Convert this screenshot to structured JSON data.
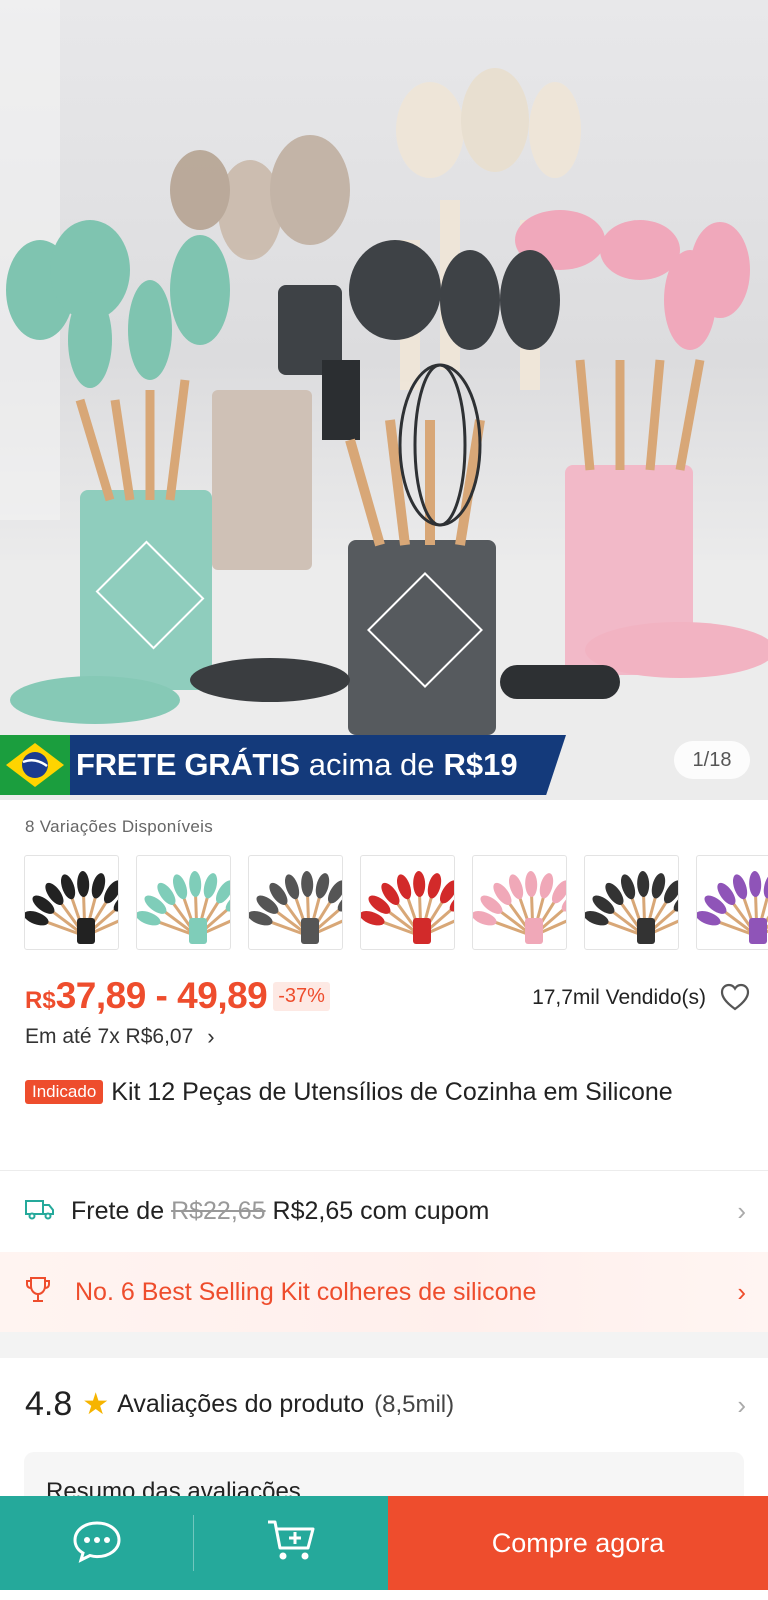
{
  "hero": {
    "frete_bold": "FRETE GRÁTIS",
    "frete_reg": "acima de",
    "frete_price": "R$19",
    "counter": "1/18"
  },
  "variations": {
    "label": "8 Variações Disponíveis",
    "thumbs": [
      {
        "name": "black",
        "color": "#222222"
      },
      {
        "name": "mint",
        "color": "#7fcdb9"
      },
      {
        "name": "gray",
        "color": "#555555"
      },
      {
        "name": "red",
        "color": "#d22a2a"
      },
      {
        "name": "pink",
        "color": "#f0a8b8"
      },
      {
        "name": "mixed",
        "color": "#333333"
      },
      {
        "name": "purple",
        "color": "#8f54b8"
      }
    ]
  },
  "price": {
    "currency": "R$",
    "range": "37,89 - 49,89",
    "discount": "-37%",
    "sold": "17,7mil Vendido(s)",
    "installments_prefix": "Em até",
    "installments_value": "7x R$6,07"
  },
  "product": {
    "badge": "Indicado",
    "title": "Kit 12 Peças de Utensílios de Cozinha em Silicone"
  },
  "shipping": {
    "prefix": "Frete de",
    "old_price": "R$22,65",
    "new_price": "R$2,65 com cupom"
  },
  "best_selling": {
    "text": "No. 6 Best Selling Kit colheres de silicone"
  },
  "rating": {
    "score": "4.8",
    "label": "Avaliações do produto",
    "count": "(8,5mil)"
  },
  "summary": {
    "title": "Resumo das avaliações"
  },
  "bottom_bar": {
    "buy_label": "Compre agora"
  },
  "colors": {
    "brand": "#ee4d2d",
    "green": "#25a99b",
    "banner_blue": "#143a7b"
  }
}
